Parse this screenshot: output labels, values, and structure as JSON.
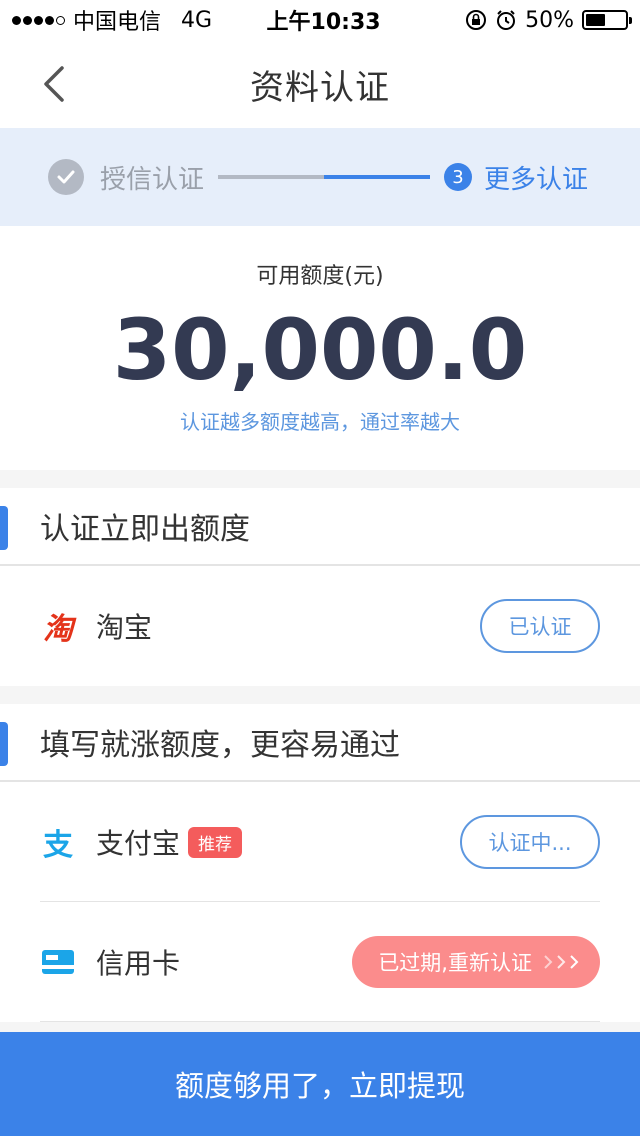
{
  "status_bar": {
    "carrier": "中国电信",
    "network": "4G",
    "time": "上午10:33",
    "battery": "50%",
    "battery_level": 0.5
  },
  "nav": {
    "title": "资料认证",
    "back_icon": "chevron-left-icon"
  },
  "steps": {
    "done_label": "授信认证",
    "current_number": "3",
    "current_label": "更多认证"
  },
  "amount": {
    "label": "可用额度(元)",
    "value": "30,000.0",
    "hint": "认证越多额度越高，通过率越大"
  },
  "section1": {
    "title": "认证立即出额度",
    "items": [
      {
        "label": "淘宝",
        "icon": "taobao-icon",
        "icon_text": "淘",
        "status": "已认证"
      }
    ]
  },
  "section2": {
    "title": "填写就涨额度，更容易通过",
    "items": [
      {
        "label": "支付宝",
        "icon": "alipay-icon",
        "icon_text": "支",
        "tag": "推荐",
        "status": "认证中..."
      },
      {
        "label": "信用卡",
        "icon": "credit-card-icon",
        "status": "已过期,重新认证"
      }
    ]
  },
  "bottom_button": {
    "label": "额度够用了，立即提现"
  },
  "colors": {
    "primary": "#3b82e8",
    "secondary_blue": "#5d97df",
    "expired": "#fb8c8c",
    "recommend": "#f45c5c",
    "taobao": "#e4331a",
    "alipay": "#1ba5e8"
  }
}
